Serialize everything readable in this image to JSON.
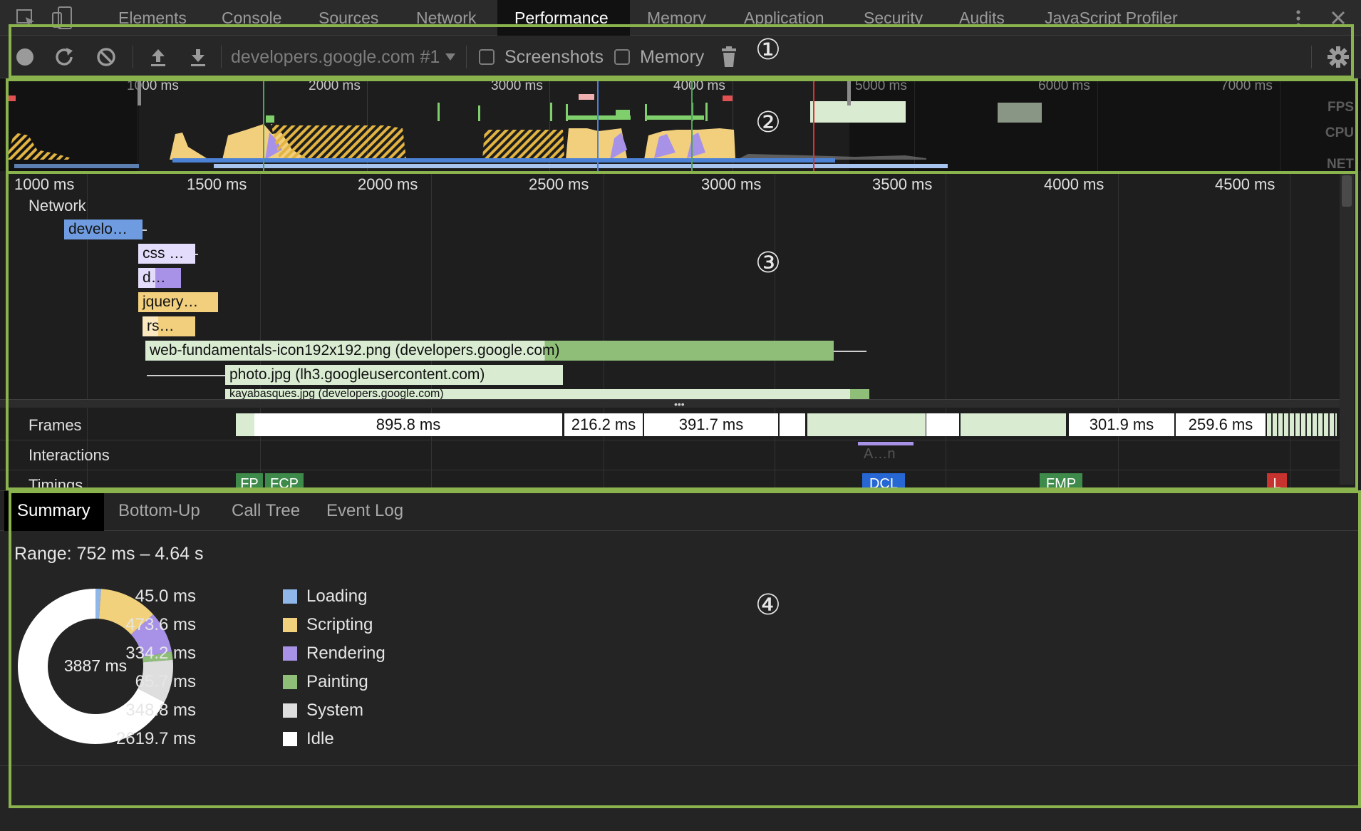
{
  "tabs": [
    "Elements",
    "Console",
    "Sources",
    "Network",
    "Performance",
    "Memory",
    "Application",
    "Security",
    "Audits",
    "JavaScript Profiler"
  ],
  "active_tab": "Performance",
  "toolbar": {
    "profile_select": "developers.google.com #1",
    "screenshots_label": "Screenshots",
    "memory_label": "Memory"
  },
  "overview": {
    "ticks": [
      "1000 ms",
      "2000 ms",
      "3000 ms",
      "4000 ms",
      "5000 ms",
      "6000 ms",
      "7000 ms"
    ],
    "labels": {
      "fps": "FPS",
      "cpu": "CPU",
      "net": "NET"
    }
  },
  "ruler": [
    "1000 ms",
    "1500 ms",
    "2000 ms",
    "2500 ms",
    "3000 ms",
    "3500 ms",
    "4000 ms",
    "4500 ms"
  ],
  "network": {
    "title": "Network",
    "requests": [
      {
        "label": "develo…",
        "color": "#6f9ce0"
      },
      {
        "label": "css …",
        "color": "#e3dcfb"
      },
      {
        "label": "d…",
        "color": "#b4a0f0"
      },
      {
        "label": "jquery…",
        "color": "#f2cf7d"
      },
      {
        "label": "rs…",
        "color": "#f2cf7d"
      },
      {
        "label": "web-fundamentals-icon192x192.png (developers.google.com)",
        "color": "#d9ecd2"
      },
      {
        "label": "photo.jpg (lh3.googleusercontent.com)",
        "color": "#d9ecd2"
      },
      {
        "label": "kayabasques.jpg (developers.google.com)",
        "color": "#d9ecd2"
      }
    ]
  },
  "tracks": {
    "frames": "Frames",
    "interactions": "Interactions",
    "timings": "Timings",
    "frame_values": [
      "895.8 ms",
      "216.2 ms",
      "391.7 ms",
      "301.9 ms",
      "259.6 ms"
    ],
    "interaction_label": "A…n",
    "timing_markers": [
      "FP",
      "FCP",
      "DCL",
      "FMP",
      "L"
    ]
  },
  "bottom_tabs": [
    "Summary",
    "Bottom-Up",
    "Call Tree",
    "Event Log"
  ],
  "summary": {
    "range": "Range: 752 ms – 4.64 s",
    "total": "3887 ms",
    "items": [
      {
        "value": "45.0 ms",
        "name": "Loading",
        "color": "#8fb7ea"
      },
      {
        "value": "473.6 ms",
        "name": "Scripting",
        "color": "#f2d17c"
      },
      {
        "value": "334.2 ms",
        "name": "Rendering",
        "color": "#a792e8"
      },
      {
        "value": "65.7 ms",
        "name": "Painting",
        "color": "#8fbe79"
      },
      {
        "value": "348.8 ms",
        "name": "System",
        "color": "#dedede"
      },
      {
        "value": "2619.7 ms",
        "name": "Idle",
        "color": "#ffffff"
      }
    ]
  },
  "callouts": [
    "①",
    "②",
    "③",
    "④"
  ]
}
